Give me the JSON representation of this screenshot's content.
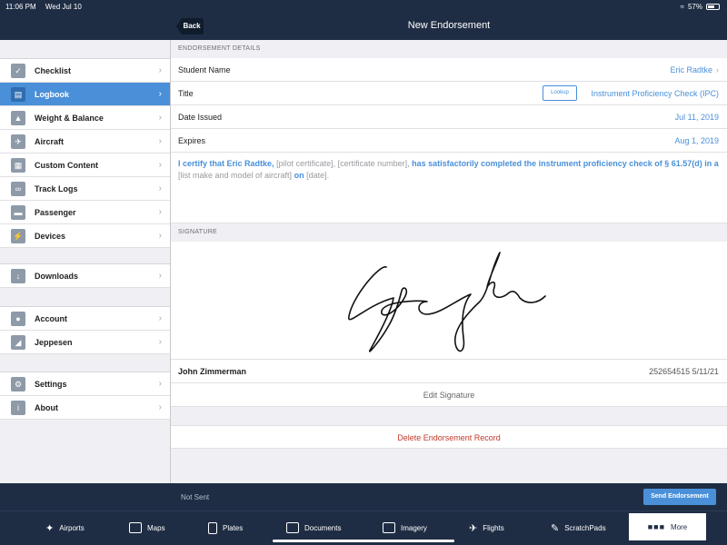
{
  "status": {
    "time": "11:06 PM",
    "date": "Wed Jul 10",
    "battery": "57%"
  },
  "nav": {
    "back_label": "Back",
    "title": "New Endorsement"
  },
  "sidebar": {
    "groups": [
      [
        {
          "label": "Checklist",
          "icon": "check-icon",
          "active": false
        },
        {
          "label": "Logbook",
          "icon": "book-icon",
          "active": true
        },
        {
          "label": "Weight & Balance",
          "icon": "weight-icon",
          "active": false
        },
        {
          "label": "Aircraft",
          "icon": "plane-icon",
          "active": false
        },
        {
          "label": "Custom Content",
          "icon": "content-icon",
          "active": false
        },
        {
          "label": "Track Logs",
          "icon": "tracklog-icon",
          "active": false
        },
        {
          "label": "Passenger",
          "icon": "passenger-icon",
          "active": false
        },
        {
          "label": "Devices",
          "icon": "plug-icon",
          "active": false
        }
      ],
      [
        {
          "label": "Downloads",
          "icon": "download-icon",
          "active": false
        }
      ],
      [
        {
          "label": "Account",
          "icon": "person-icon",
          "active": false
        },
        {
          "label": "Jeppesen",
          "icon": "jeppesen-icon",
          "active": false
        }
      ],
      [
        {
          "label": "Settings",
          "icon": "gear-icon",
          "active": false
        },
        {
          "label": "About",
          "icon": "info-icon",
          "active": false
        }
      ]
    ]
  },
  "details": {
    "header": "ENDORSEMENT DETAILS",
    "student_label": "Student Name",
    "student_value": "Eric Radtke",
    "title_label": "Title",
    "lookup_label": "Lookup",
    "title_value": "Instrument Proficiency Check (IPC)",
    "issued_label": "Date Issued",
    "issued_value": "Jul 11, 2019",
    "expires_label": "Expires",
    "expires_value": "Aug 1, 2019"
  },
  "cert": {
    "s1": "I certify that Eric Radtke,",
    "p1": "[pilot certificate], [certificate number],",
    "s2": "has satisfactorily completed the instrument proficiency check of § 61.57(d) in a",
    "p2": "[list make and model of aircraft]",
    "s3": "on",
    "p3": "[date]."
  },
  "signature": {
    "header": "SIGNATURE",
    "name": "John Zimmerman",
    "meta": "252654515 5/11/21",
    "edit_label": "Edit Signature",
    "delete_label": "Delete Endorsement Record"
  },
  "action": {
    "status": "Not Sent",
    "send_label": "Send Endorsement"
  },
  "tabs": [
    {
      "label": "Airports",
      "icon": "airports-icon"
    },
    {
      "label": "Maps",
      "icon": "maps-icon"
    },
    {
      "label": "Plates",
      "icon": "plates-icon"
    },
    {
      "label": "Documents",
      "icon": "documents-icon"
    },
    {
      "label": "Imagery",
      "icon": "imagery-icon"
    },
    {
      "label": "Flights",
      "icon": "flights-icon"
    },
    {
      "label": "ScratchPads",
      "icon": "scratchpad-icon"
    },
    {
      "label": "More",
      "icon": "more-icon"
    }
  ]
}
